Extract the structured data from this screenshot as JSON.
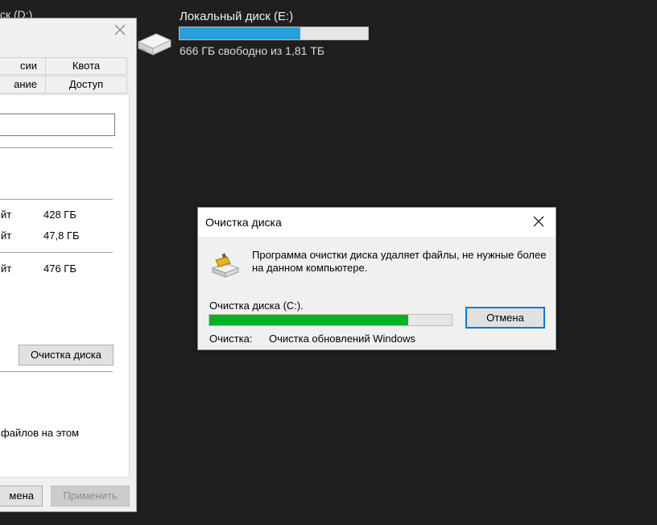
{
  "desktop": {
    "top_cut_label": "ск (D:)",
    "drive_e": {
      "name": "Локальный диск (E:)",
      "free_text": "666 ГБ свободно из 1,81 ТБ",
      "used_fraction": 0.64,
      "icon": "hard-drive-icon"
    }
  },
  "properties_dialog": {
    "tabs": [
      "сии",
      "Квота",
      "ание",
      "Доступ"
    ],
    "rows": [
      {
        "label": "йт",
        "value": "428 ГБ"
      },
      {
        "label": "йт",
        "value": "47,8 ГБ"
      },
      {
        "label": "йт",
        "value": "476 ГБ"
      }
    ],
    "cleanup_button": "Очистка диска",
    "files_text": "файлов на этом",
    "cancel_button": "мена",
    "apply_button": "Применить"
  },
  "cleanup_dialog": {
    "title": "Очистка диска",
    "description": "Программа очистки диска удаляет файлы, не нужные более на данном компьютере.",
    "drive_label": "Очистка диска  (C:).",
    "progress_fraction": 0.82,
    "cancel_button": "Отмена",
    "status_label": "Очистка:",
    "status_value": "Очистка обновлений Windows",
    "icon": "disk-cleanup-brush-icon",
    "colors": {
      "progress": "#06b025",
      "focus": "#0078d7"
    }
  }
}
